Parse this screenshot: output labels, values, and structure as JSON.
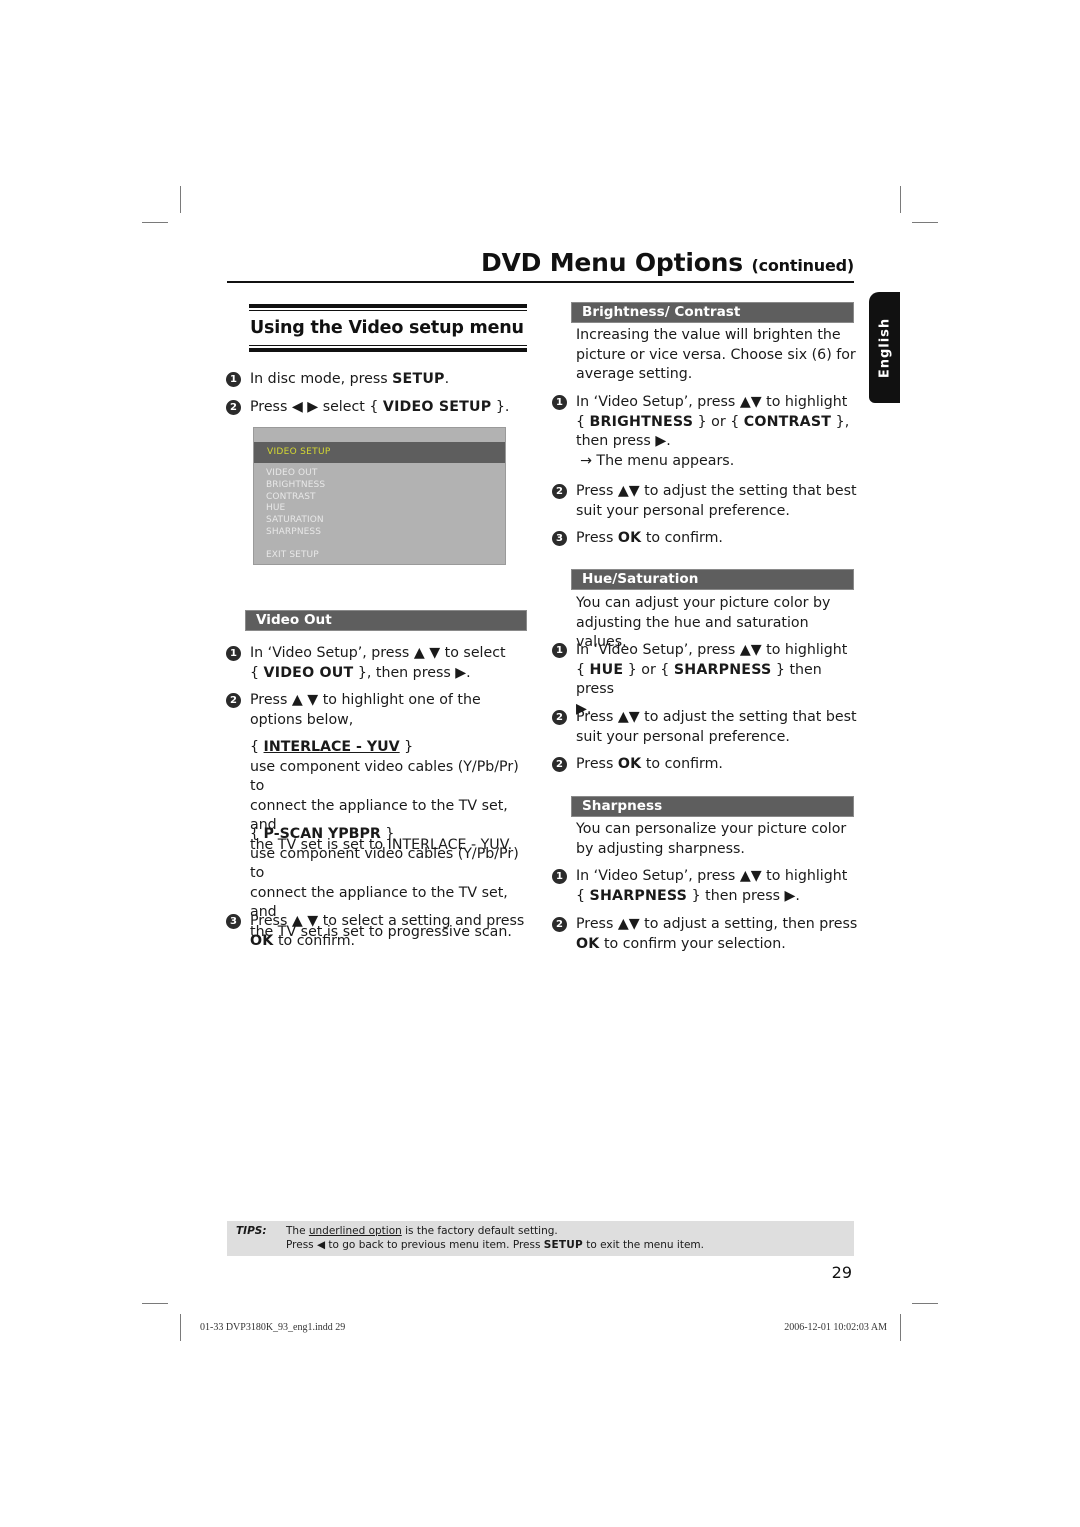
{
  "header": {
    "title": "DVD Menu Options",
    "title_suffix": "(continued)"
  },
  "language_tab": "English",
  "left": {
    "section_title": "Using the Video setup menu",
    "intro_steps": [
      {
        "num": "1",
        "pre": "In disc mode, press ",
        "bold": "SETUP",
        "post": "."
      },
      {
        "num": "2",
        "pre": "Press ◀ ▶ select { ",
        "bold": "VIDEO SETUP",
        "post": " }."
      }
    ],
    "menu_screenshot": {
      "header": "VIDEO  SETUP",
      "items": [
        "VIDEO OUT",
        "BRIGHTNESS",
        "CONTRAST",
        "HUE",
        "SATURATION",
        "SHARPNESS"
      ],
      "exit": "EXIT SETUP"
    },
    "video_out": {
      "bar": "Video Out",
      "step1_num": "1",
      "step1_a": "In ‘Video Setup’, press ▲ ▼ to select",
      "step1_b_pre": "{ ",
      "step1_b_bold": "VIDEO OUT",
      "step1_b_post": " }, then press ▶.",
      "step2_num": "2",
      "step2_a": "Press ▲ ▼ to highlight one of the",
      "step2_b": "options below,",
      "options": [
        {
          "title": "INTERLACE - YUV",
          "default": true,
          "desc": [
            "use component video cables (Y/Pb/Pr) to",
            "connect the appliance to the TV set, and",
            "the TV set is set to INTERLACE - YUV."
          ]
        },
        {
          "title": "P-SCAN YPBPR",
          "default": false,
          "desc": [
            "use component video cables (Y/Pb/Pr) to",
            "connect the appliance to the TV set, and",
            "the TV set is set to progressive scan."
          ]
        }
      ],
      "step3_num": "3",
      "step3_a": "Press ▲ ▼ to select a setting and press",
      "step3_b_bold": "OK",
      "step3_b_post": " to confirm."
    }
  },
  "right": {
    "brightness": {
      "bar": "Brightness/ Contrast",
      "desc": [
        "Increasing the value will brighten the",
        "picture or vice versa. Choose six (6) for",
        "average setting."
      ],
      "step1_num": "1",
      "step1_a": "In ‘Video Setup’, press ▲▼ to highlight",
      "step1_b_bold1": "BRIGHTNESS",
      "step1_b_mid": " } or { ",
      "step1_b_bold2": "CONTRAST",
      "step1_b_post": " },",
      "step1_c": "then press ▶.",
      "step1_result": "→ The menu appears.",
      "step2_num": "2",
      "step2_a": "Press ▲▼ to adjust the setting that best",
      "step2_b": "suit your personal preference.",
      "step3_num": "3",
      "step3_pre": "Press ",
      "step3_bold": "OK",
      "step3_post": " to confirm."
    },
    "hue": {
      "bar": "Hue/Saturation",
      "desc": [
        "You can adjust your picture color by",
        "adjusting the hue and saturation values."
      ],
      "step1_num": "1",
      "step1_a": "In ‘Video Setup’, press ▲▼ to highlight",
      "step1_b_bold1": "HUE",
      "step1_b_mid": " } or { ",
      "step1_b_bold2": "SHARPNESS",
      "step1_b_post": " } then press",
      "step1_c": "▶.",
      "step2_num": "2",
      "step2_a": "Press ▲▼ to adjust the setting that best",
      "step2_b": "suit your personal preference.",
      "step3_num": "2",
      "step3_pre": "Press ",
      "step3_bold": "OK",
      "step3_post": " to confirm."
    },
    "sharpness": {
      "bar": "Sharpness",
      "desc": [
        "You can personalize your picture color",
        "by adjusting sharpness."
      ],
      "step1_num": "1",
      "step1_a": "In ‘Video Setup’, press ▲▼ to highlight",
      "step1_b_bold": "SHARPNESS",
      "step1_b_post": " } then press ▶.",
      "step2_num": "2",
      "step2_a": "Press ▲▼ to adjust a setting, then press",
      "step2_b_bold": "OK",
      "step2_b_post": " to confirm your selection."
    }
  },
  "tips": {
    "label": "TIPS:",
    "line1_pre": "The ",
    "line1_underlined": "underlined option",
    "line1_post": " is the factory default setting.",
    "line2_pre": "Press  ◀ to go back to previous menu item. Press ",
    "line2_bold": "SETUP",
    "line2_post": " to exit the menu item."
  },
  "page_number": "29",
  "slug": {
    "file": "01-33 DVP3180K_93_eng1.indd   29",
    "timestamp": "2006-12-01   10:02:03 AM"
  }
}
